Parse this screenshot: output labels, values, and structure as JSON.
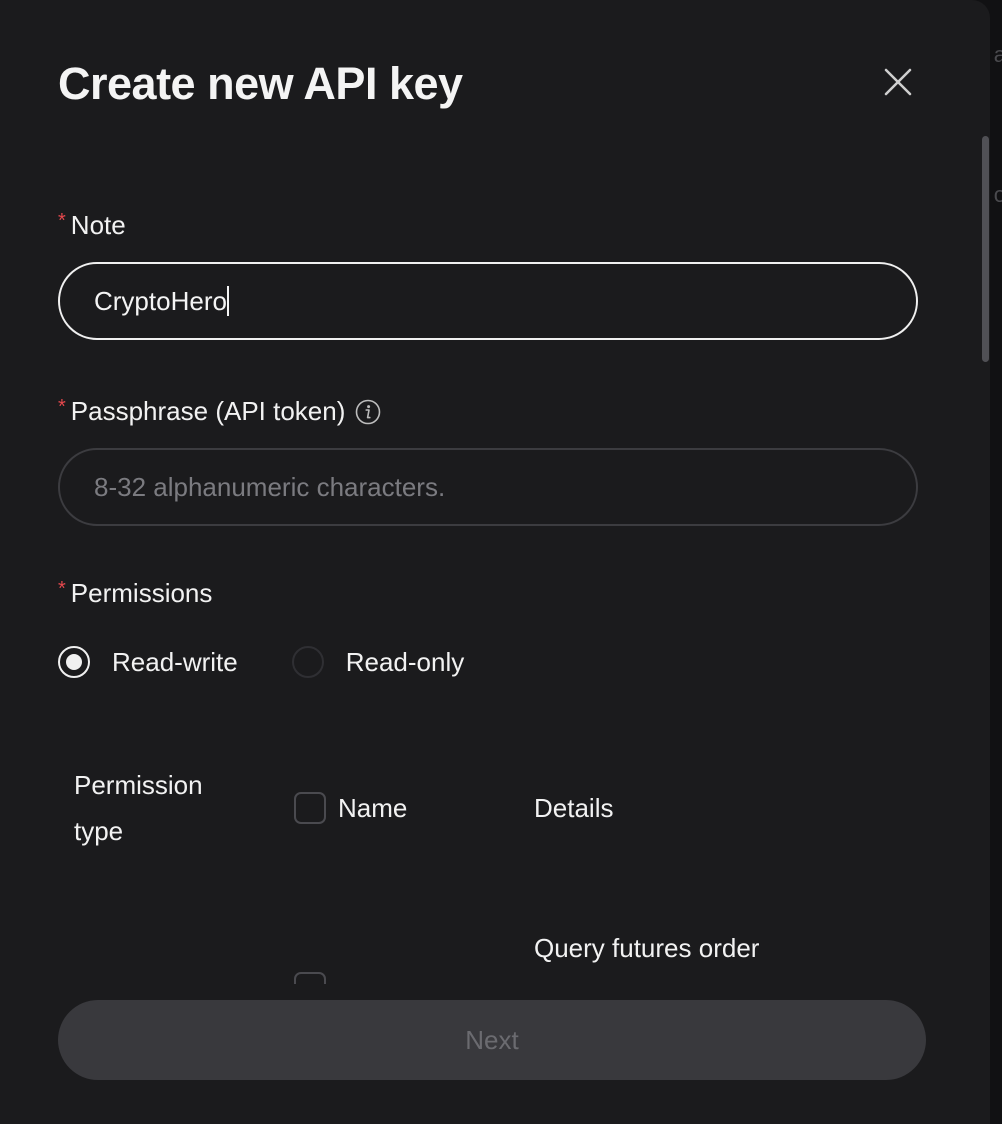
{
  "modal": {
    "title": "Create new API key"
  },
  "note_field": {
    "label": "Note",
    "value": "CryptoHero"
  },
  "passphrase_field": {
    "label": "Passphrase (API token)",
    "placeholder": "8-32 alphanumeric characters."
  },
  "permissions": {
    "label": "Permissions",
    "options": [
      "Read-write",
      "Read-only"
    ],
    "selected": "Read-write"
  },
  "table": {
    "headers": {
      "type_line1": "Permission",
      "type_line2": "type",
      "name": "Name",
      "details": "Details"
    },
    "first_row_details": "Query futures order"
  },
  "footer": {
    "next_label": "Next"
  },
  "colors": {
    "required_star": "#e5484d",
    "background": "#1b1b1d"
  }
}
